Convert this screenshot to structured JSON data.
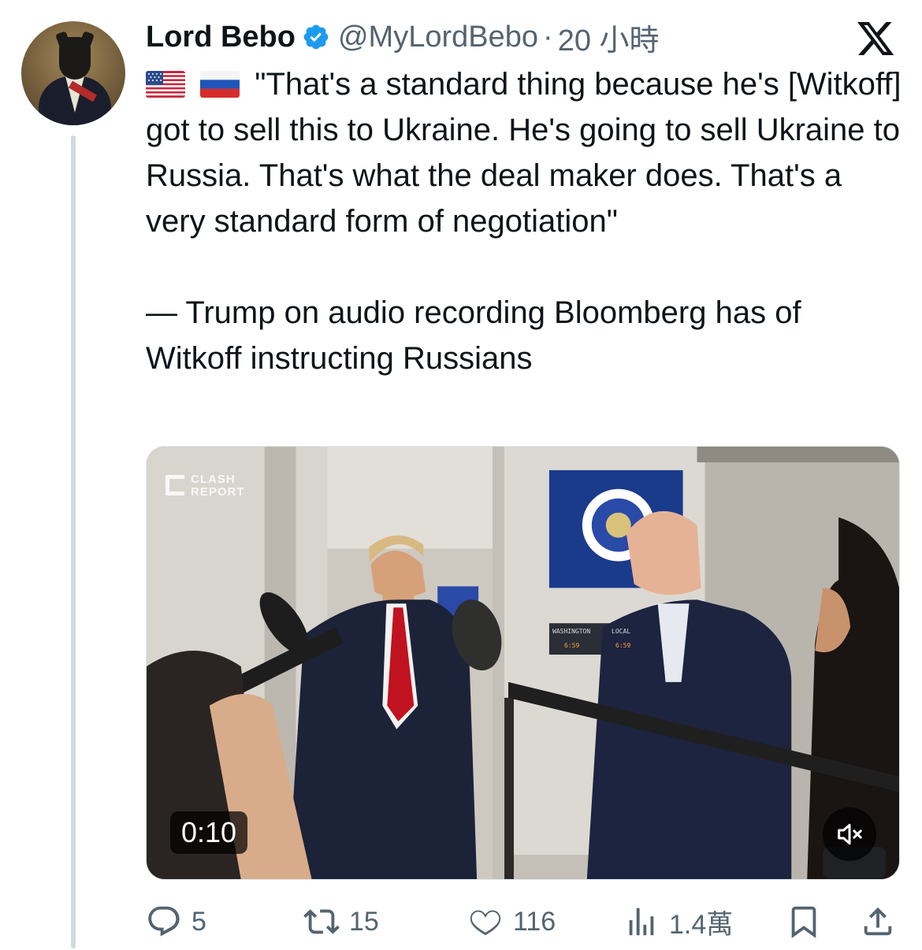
{
  "tweet": {
    "display_name": "Lord Bebo",
    "handle": "@MyLordBebo",
    "separator": "·",
    "timestamp": "20 小時",
    "flags": [
      "us-flag",
      "russia-flag"
    ],
    "text_lines": [
      "\"That's a standard thing because he's [Witkoff] got to sell this to Ukraine. He's going to sell Ukraine to Russia. That's what the deal maker does. That's a very standard form of negotiation\"",
      "— Trump on audio recording Bloomberg has of Witkoff instructing Russians"
    ],
    "verified_color": "#1d9bf0"
  },
  "media": {
    "watermark_line1": "CLASH",
    "watermark_line2": "REPORT",
    "duration": "0:10",
    "monitor_label_left": "WASHINGTON",
    "monitor_label_right": "LOCAL",
    "monitor_time_left": "6:59",
    "monitor_time_right": "6:59",
    "mute_icon": "speaker-muted-icon"
  },
  "actions": {
    "replies": "5",
    "reposts": "15",
    "likes": "116",
    "views": "1.4萬"
  },
  "colors": {
    "text_primary": "#0f1419",
    "text_secondary": "#536471",
    "accent": "#1d9bf0",
    "thread_line": "#cfd9de"
  }
}
